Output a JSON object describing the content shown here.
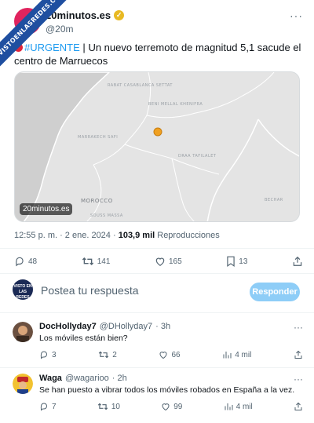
{
  "watermark": {
    "text": "VISTOENLASREDES.COM"
  },
  "tweet": {
    "author_name": "20minutos.es",
    "handle": "@20m",
    "hashtag": "#URGENTE",
    "separator": "|",
    "text": "Un nuevo terremoto de magnitud 5,1 sacude el centro de Marruecos",
    "timestamp": "12:55 p. m. · 2 ene. 2024 · ",
    "views_count": "103,9 mil",
    "views_label": " Reproducciones",
    "more": "···"
  },
  "map": {
    "badge": "20minutos.es",
    "country_label": "MOROCCO",
    "region_labels": [
      "RABAT CASABLANCA SETTAT",
      "BENI MELLAL KHENIFRA",
      "MARRAKECH SAFI",
      "DRAA TAFILALET",
      "SOUSS MASSA",
      "BECHAR"
    ],
    "marker_color": "#f0a020"
  },
  "stats": {
    "replies": "48",
    "retweets": "141",
    "likes": "165",
    "bookmarks": "13"
  },
  "compose": {
    "avatar_text": "VISTO EN LAS REDES",
    "placeholder": "Postea tu respuesta",
    "button": "Responder"
  },
  "replies": [
    {
      "name": "DocHollyday7",
      "handle": "@DHollyday7",
      "time": "· 3h",
      "text": "Los móviles están bien?",
      "replies": "3",
      "retweets": "2",
      "likes": "66",
      "views": "4 mil",
      "more": "···"
    },
    {
      "name": "Waga",
      "handle": "@wagarioo",
      "time": "· 2h",
      "text": "Se han puesto a vibrar todos los móviles robados en España a la vez.",
      "replies": "7",
      "retweets": "10",
      "likes": "99",
      "views": "4 mil",
      "more": "···"
    }
  ],
  "colors": {
    "accent": "#1d9bf0",
    "muted": "#536471",
    "text": "#0f1419",
    "reply_button": "#8ecdf7"
  }
}
